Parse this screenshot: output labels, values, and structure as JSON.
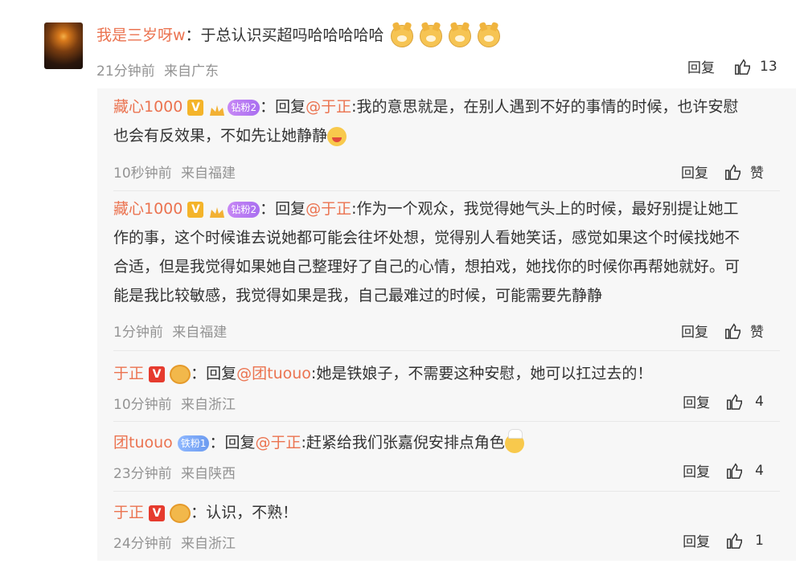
{
  "main_comment": {
    "user": "我是三岁呀w",
    "text": "：于总认识买超吗哈哈哈哈哈",
    "time": "21分钟前",
    "source": "来自广东",
    "reply_label": "回复",
    "like_count": "13"
  },
  "replies": [
    {
      "user": "藏心1000",
      "fan_badge": "钻粉2",
      "prefix": "：回复",
      "mention": "@于正",
      "text_line1": ":我的意思就是，在别人遇到不好的事情的时候，也许安慰",
      "text_line2": "也会有反效果，不如先让她静静",
      "time": "10秒钟前",
      "source": "来自福建",
      "reply_label": "回复",
      "like_label": "赞"
    },
    {
      "user": "藏心1000",
      "fan_badge": "钻粉2",
      "prefix": "：回复",
      "mention": "@于正",
      "text_line1": ":作为一个观众，我觉得她气头上的时候，最好别提让她工",
      "text_line2": "作的事，这个时候谁去说她都可能会往坏处想，觉得别人看她笑话，感觉如果这个时候找她不",
      "text_line3": "合适，但是我觉得如果她自己整理好了自己的心情，想拍戏，她找你的时候你再帮她就好。可",
      "text_line4": "能是我比较敏感，我觉得如果是我，自己最难过的时候，可能需要先静静",
      "time": "1分钟前",
      "source": "来自福建",
      "reply_label": "回复",
      "like_label": "赞"
    },
    {
      "user": "于正",
      "prefix": "：回复",
      "mention": "@团tuouo",
      "text_line1": ":她是铁娘子，不需要这种安慰，她可以扛过去的！",
      "time": "10分钟前",
      "source": "来自浙江",
      "reply_label": "回复",
      "like_count": "4"
    },
    {
      "user": "团tuouo",
      "fan_badge": "铁粉1",
      "prefix": "：回复",
      "mention": "@于正",
      "text_line1": ":赶紧给我们张嘉倪安排点角色",
      "time": "23分钟前",
      "source": "来自陕西",
      "reply_label": "回复",
      "like_count": "4"
    },
    {
      "user": "于正",
      "text_line1": "：认识，不熟！",
      "time": "24分钟前",
      "source": "来自浙江",
      "reply_label": "回复",
      "like_count": "1"
    }
  ],
  "colors": {
    "username": "#eb7350",
    "meta": "#939393",
    "reply_bg": "#f7f7f7"
  },
  "icons": [
    "dog-emoji-icon",
    "v-badge-icon",
    "crown-icon",
    "thumb-up-icon",
    "cook-emoji-icon"
  ]
}
